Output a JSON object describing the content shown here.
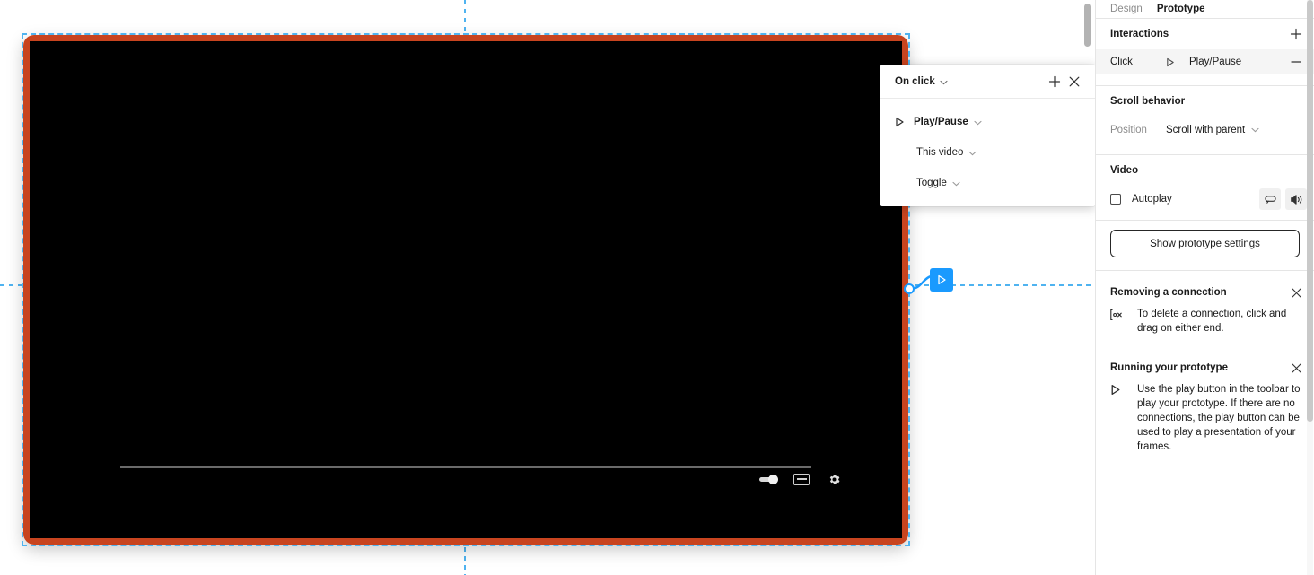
{
  "panel": {
    "tabs": [
      {
        "label": "Design",
        "active": false
      },
      {
        "label": "Prototype",
        "active": true
      }
    ],
    "interactions": {
      "title": "Interactions",
      "add_label": "+",
      "row": {
        "trigger": "Click",
        "action": "Play/Pause",
        "remove_label": "−",
        "play_icon": "play-triangle-icon"
      }
    },
    "scroll_behavior": {
      "title": "Scroll behavior",
      "position_label": "Position",
      "position_value": "Scroll with parent"
    },
    "video": {
      "title": "Video",
      "autoplay_label": "Autoplay",
      "autoplay_checked": false,
      "loop_icon": "loop-icon",
      "volume_icon": "volume-icon"
    },
    "prototype_settings_button": "Show prototype settings",
    "tips": [
      {
        "title": "Removing a connection",
        "text": "To delete a connection, click and drag on either end.",
        "icon": "remove-connection-icon",
        "close_label": "×"
      },
      {
        "title": "Running your prototype",
        "text": "Use the play button in the toolbar to play your prototype. If there are no connections, the play button can be used to play a presentation of your frames.",
        "icon": "play-triangle-icon",
        "close_label": "×"
      }
    ]
  },
  "popup": {
    "title": "On click",
    "add_label": "+",
    "close_label": "×",
    "action": "Play/Pause",
    "target": "This video",
    "mode": "Toggle"
  },
  "canvas": {
    "frame_border_color": "#c8441f",
    "frame_fill_color": "#000000",
    "selection_color": "#4fb3f0",
    "connection_color": "#1a9afe",
    "player": {
      "progress_label": "video-progress-bar",
      "volume_label": "volume-slider",
      "cc_label": "CC",
      "settings_label": "settings-gear"
    }
  }
}
